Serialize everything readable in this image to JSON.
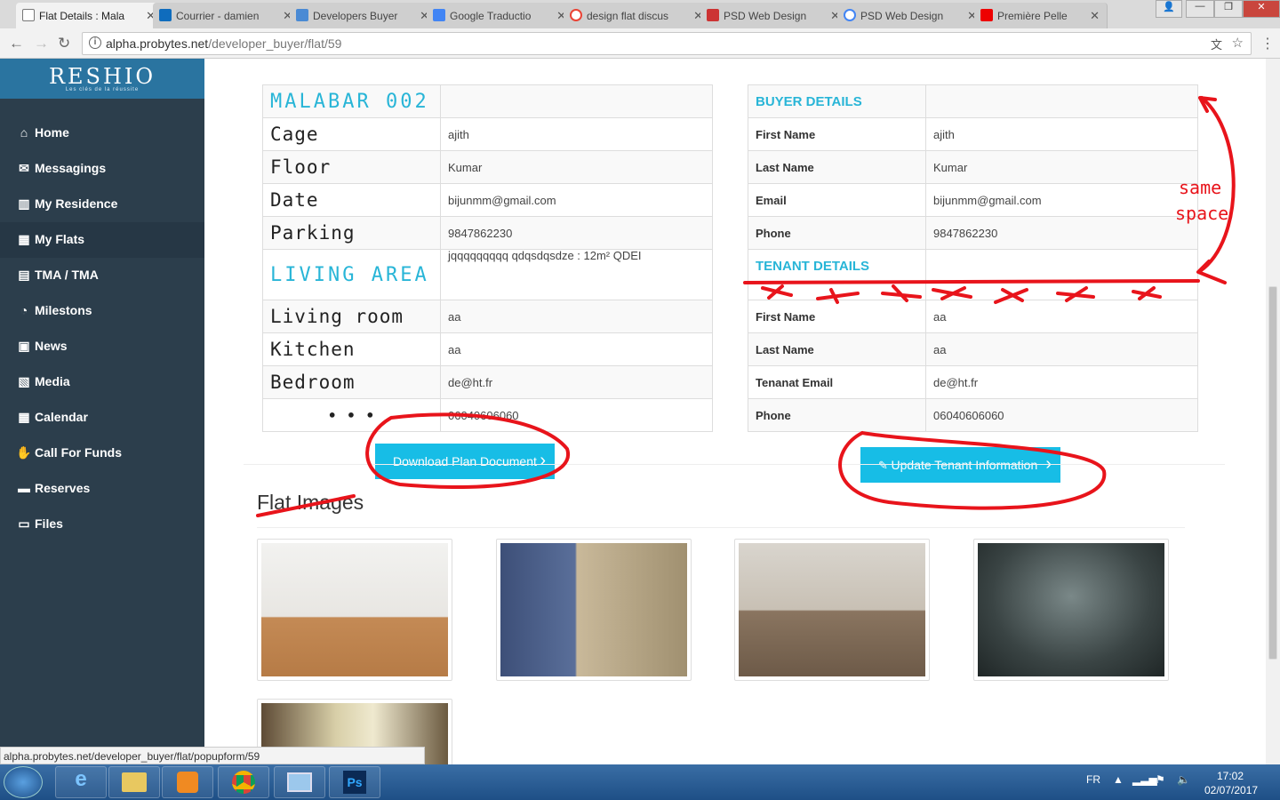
{
  "browser": {
    "tabs": [
      {
        "title": "Flat Details : Mala",
        "active": true
      },
      {
        "title": "Courrier - damien"
      },
      {
        "title": "Developers Buyer"
      },
      {
        "title": "Google Traductio"
      },
      {
        "title": "design flat discus"
      },
      {
        "title": "PSD Web Design"
      },
      {
        "title": "PSD Web Design"
      },
      {
        "title": "Première Pelle"
      }
    ],
    "url_domain": "alpha.probytes.net",
    "url_path": "/developer_buyer/flat/59",
    "status_url": "alpha.probytes.net/developer_buyer/flat/popupform/59"
  },
  "sidebar": {
    "logo": "RESHIO",
    "logo_tagline": "Les clés de la réussite",
    "items": [
      {
        "label": "Home",
        "icon": "home-icon"
      },
      {
        "label": "Messagings",
        "icon": "envelope-icon"
      },
      {
        "label": "My Residence",
        "icon": "building-icon"
      },
      {
        "label": "My Flats",
        "icon": "grid-icon",
        "active": true
      },
      {
        "label": "TMA / TMA",
        "icon": "tma-icon"
      },
      {
        "label": "Milestons",
        "icon": "milestone-icon"
      },
      {
        "label": "News",
        "icon": "newspaper-icon"
      },
      {
        "label": "Media",
        "icon": "image-icon"
      },
      {
        "label": "Calendar",
        "icon": "calendar-icon"
      },
      {
        "label": "Call For Funds",
        "icon": "funds-icon"
      },
      {
        "label": "Reserves",
        "icon": "reserves-icon"
      },
      {
        "label": "Files",
        "icon": "folder-icon"
      }
    ]
  },
  "flat": {
    "title": "MALABAR 002",
    "rows": [
      {
        "label": "Cage",
        "value": "ajith"
      },
      {
        "label": "Floor",
        "value": "Kumar"
      },
      {
        "label": "Date",
        "value": "bijunmm@gmail.com"
      },
      {
        "label": "Parking",
        "value": "9847862230"
      }
    ],
    "living_area_label": "LIVING AREA",
    "living_area_value": "jqqqqqqqqq qdqsdqsdze : 12m² QDEI",
    "rooms": [
      {
        "label": "Living room",
        "value": "aa"
      },
      {
        "label": "Kitchen",
        "value": "aa"
      },
      {
        "label": "Bedroom",
        "value": "de@ht.fr"
      },
      {
        "label": "• • •",
        "value": "06040606060"
      }
    ]
  },
  "buyer": {
    "title": "BUYER DETAILS",
    "rows": [
      {
        "label": "First Name",
        "value": "ajith"
      },
      {
        "label": "Last Name",
        "value": "Kumar"
      },
      {
        "label": "Email",
        "value": "bijunmm@gmail.com"
      },
      {
        "label": "Phone",
        "value": "9847862230"
      }
    ]
  },
  "tenant": {
    "title": "TENANT DETAILS",
    "rows": [
      {
        "label": "First Name",
        "value": "aa"
      },
      {
        "label": "Last Name",
        "value": "aa"
      },
      {
        "label": "Tenanat Email",
        "value": "de@ht.fr"
      },
      {
        "label": "Phone",
        "value": "06040606060"
      }
    ]
  },
  "buttons": {
    "download": "Download Plan Document",
    "update": "Update Tenant Information"
  },
  "images_title": "Flat Images",
  "annotation": {
    "line1": "same",
    "line2": "space"
  },
  "taskbar": {
    "lang": "FR",
    "time": "17:02",
    "date": "02/07/2017"
  },
  "colors": {
    "accent": "#17bde6",
    "sidebar": "#2c3e4c",
    "annotation": "#e8141b"
  }
}
